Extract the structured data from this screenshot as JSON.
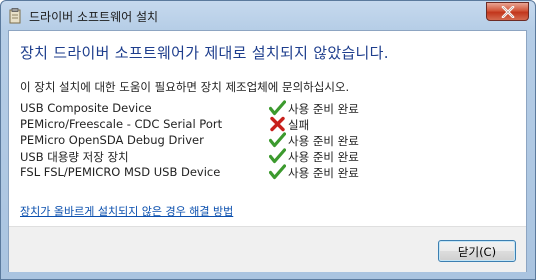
{
  "window": {
    "title": "드라이버 소프트웨어 설치"
  },
  "heading": "장치 드라이버 소프트웨어가 제대로 설치되지 않았습니다.",
  "subtext": "이 장치 설치에 대한 도움이 필요하면 장치 제조업체에 문의하십시오.",
  "devices": [
    {
      "name": "USB Composite Device",
      "status": "사용 준비 완료",
      "icon": "check-icon"
    },
    {
      "name": "PEMicro/Freescale - CDC Serial Port",
      "status": "실패",
      "icon": "x-icon"
    },
    {
      "name": "PEMicro OpenSDA Debug Driver",
      "status": "사용 준비 완료",
      "icon": "check-icon"
    },
    {
      "name": "USB 대용량 저장 장치",
      "status": "사용 준비 완료",
      "icon": "check-icon"
    },
    {
      "name": "FSL FSL/PEMICRO MSD USB Device",
      "status": "사용 준비 완료",
      "icon": "check-icon"
    }
  ],
  "help_link": "장치가 올바르게 설치되지 않은 경우 해결 방법",
  "buttons": {
    "close_label": "닫기(C)"
  },
  "colors": {
    "heading": "#1e3e8d",
    "link": "#0a4fae",
    "success": "#3c9a2e",
    "failure": "#c8201c"
  }
}
